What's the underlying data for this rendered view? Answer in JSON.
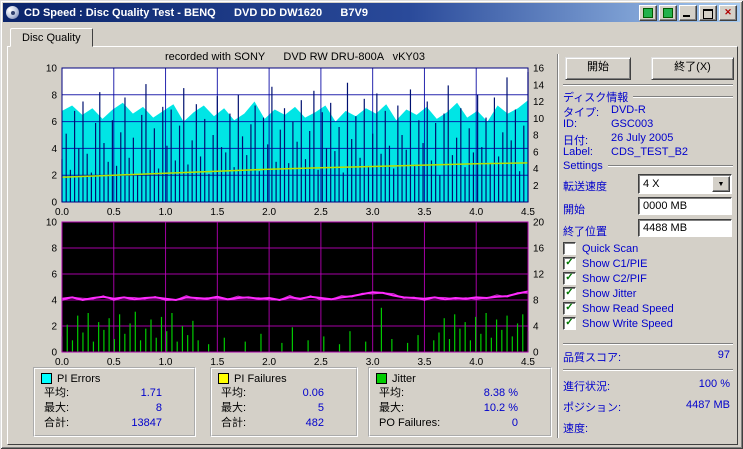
{
  "colors": {
    "panel_text_blue": "#0000cc",
    "check_green": "#007800",
    "titlebar_gradient": [
      "#0a246a",
      "#a6caf0"
    ]
  },
  "window": {
    "title": "CD Speed : Disc Quality Test - BENQ      DVD DD DW1620      B7V9",
    "controls": {
      "close_glyph": "✕"
    }
  },
  "tab": {
    "label": "Disc Quality"
  },
  "chart_header": "recorded with SONY      DVD RW DRU-800A   vKY03",
  "chart_data": [
    {
      "type": "bar",
      "name": "pi-errors-chart",
      "title": "PI Errors (C1/PIE) with write speed",
      "x_range": [
        0,
        4.5
      ],
      "xticks": [
        "0.0",
        "0.5",
        "1.0",
        "1.5",
        "2.0",
        "2.5",
        "3.0",
        "3.5",
        "4.0",
        "4.5"
      ],
      "ylim_left": [
        0,
        10
      ],
      "yticks_left": [
        10,
        8,
        6,
        4,
        2,
        0
      ],
      "ylim_right": [
        0,
        16
      ],
      "yticks_right": [
        16,
        14,
        12,
        10,
        8,
        6,
        4,
        2
      ],
      "grid": true,
      "bg": "#ffffff",
      "grid_color": "#0000a0",
      "border_color": "#000080",
      "stats": {
        "average": 1.71,
        "maximum": 8,
        "total": 13847
      },
      "area": {
        "name": "pie-error-mass",
        "color": "#00e5e5",
        "top_values": [
          6.8,
          7.2,
          6.5,
          7.0,
          6.2,
          6.9,
          7.4,
          6.6,
          7.1,
          6.3,
          6.8,
          7.3,
          6.0,
          6.7,
          7.2,
          6.4,
          7.0,
          6.1,
          6.6,
          7.5,
          6.2,
          6.9,
          6.5,
          7.1,
          6.3,
          6.7,
          7.2,
          6.0,
          6.8,
          6.4,
          7.0,
          6.6,
          7.3,
          6.1,
          6.9,
          6.5,
          7.1,
          6.2,
          6.7,
          7.4,
          6.3,
          6.8,
          6.0,
          7.2,
          6.6,
          7.0,
          7.6
        ]
      },
      "spikes": {
        "name": "pie-error-spikes",
        "color": "#001070",
        "values": [
          3.2,
          5.1,
          2.4,
          6.8,
          4.0,
          7.5,
          3.6,
          2.2,
          5.9,
          8.2,
          4.4,
          3.0,
          6.1,
          2.7,
          5.2,
          7.8,
          3.3,
          4.8,
          2.0,
          6.5,
          8.8,
          3.9,
          5.5,
          2.5,
          7.1,
          4.2,
          6.9,
          3.1,
          5.7,
          8.5,
          2.8,
          4.6,
          7.3,
          3.4,
          6.2,
          2.1,
          5.0,
          7.9,
          4.1,
          3.7,
          6.6,
          2.6,
          8.0,
          4.9,
          3.5,
          5.8,
          7.2,
          2.3,
          6.3,
          4.3,
          8.6,
          3.0,
          5.4,
          7.0,
          2.9,
          6.0,
          4.5,
          7.6,
          3.2,
          5.3,
          8.3,
          2.4,
          6.7,
          4.0,
          7.4,
          3.8,
          5.6,
          2.2,
          8.9,
          4.7,
          6.4,
          3.3,
          7.7,
          2.7,
          5.1,
          8.1,
          3.6,
          6.8,
          4.2,
          2.5,
          7.2,
          5.0,
          3.9,
          8.4,
          2.8,
          6.1,
          4.4,
          7.5,
          3.1,
          5.9,
          2.0,
          6.6,
          8.7,
          3.5,
          4.8,
          7.0,
          2.6,
          5.5,
          3.7,
          8.0,
          4.1,
          6.3,
          2.9,
          7.8,
          3.4,
          5.2,
          9.3,
          4.6,
          6.9,
          2.3,
          5.7,
          9.7
        ]
      },
      "line": {
        "name": "write-speed-line",
        "color": "#b8e000",
        "width": 1.5,
        "fuzz": false,
        "points_y": [
          1.85,
          2.0,
          2.15,
          2.3,
          2.45,
          2.55,
          2.65,
          2.75,
          2.85,
          2.92
        ]
      }
    },
    {
      "type": "bar",
      "name": "pif-jitter-chart",
      "title": "PI Failures (C2/PIF) with Jitter",
      "x_range": [
        0,
        4.5
      ],
      "xticks": [
        "0.0",
        "0.5",
        "1.0",
        "1.5",
        "2.0",
        "2.5",
        "3.0",
        "3.5",
        "4.0",
        "4.5"
      ],
      "ylim_left": [
        0,
        10
      ],
      "yticks_left": [
        10,
        8,
        6,
        4,
        2,
        0
      ],
      "ylim_right": [
        0,
        20
      ],
      "yticks_right": [
        20,
        16,
        12,
        8,
        4,
        0
      ],
      "grid": true,
      "bg": "#000000",
      "grid_color": "#c000c0",
      "border_color": "#aa00aa",
      "stats": {
        "pif_average": 0.06,
        "pif_maximum": 5,
        "pif_total": 482,
        "jitter_average_pct": 8.38,
        "jitter_maximum_pct": 10.2,
        "po_failures": 0
      },
      "spikes": {
        "name": "pif-spikes",
        "color": "#00cc00",
        "values": [
          1.2,
          2.1,
          0.9,
          2.8,
          1.5,
          3.0,
          0.8,
          2.3,
          1.7,
          2.6,
          1.0,
          2.9,
          1.4,
          2.2,
          3.1,
          0.9,
          1.8,
          2.5,
          1.1,
          2.7,
          1.6,
          3.0,
          0.8,
          2.0,
          1.3,
          2.4,
          0.9,
          0,
          0.6,
          0,
          0,
          1.1,
          0,
          0,
          0,
          0.8,
          0,
          0,
          1.4,
          0,
          0,
          0,
          0.7,
          0,
          1.9,
          0,
          0,
          0.9,
          0,
          0,
          1.2,
          0,
          0,
          0.6,
          0,
          1.6,
          0,
          0,
          0.8,
          0,
          0,
          3.4,
          0,
          1.0,
          0,
          0,
          0.7,
          0,
          1.3,
          0,
          0,
          0.9,
          1.5,
          2.6,
          1.0,
          2.9,
          1.8,
          2.3,
          0.9,
          2.7,
          1.4,
          3.0,
          1.1,
          2.5,
          1.7,
          2.8,
          1.2,
          2.2,
          2.9,
          1.6
        ]
      },
      "line": {
        "name": "jitter-line",
        "color": "#ff2bff",
        "width": 2,
        "fuzz": true,
        "points_y": [
          4.1,
          4.2,
          4.0,
          4.15,
          4.25,
          4.1,
          4.2,
          4.05,
          4.15,
          4.2,
          4.1,
          4.0,
          4.2,
          4.15,
          4.1,
          4.25,
          4.05,
          4.15,
          4.2,
          4.1,
          4.15,
          4.0,
          4.2,
          4.1,
          4.25,
          4.15,
          4.05,
          4.2,
          4.3,
          4.45,
          4.6,
          4.55,
          4.35,
          4.2,
          4.15,
          4.1,
          4.2,
          4.05,
          4.15,
          4.1,
          4.2,
          4.15,
          4.25,
          4.3,
          4.5,
          4.65
        ]
      }
    }
  ],
  "legend_boxes": [
    {
      "title": "PI Errors",
      "color": "#00ffff",
      "rows": [
        {
          "label": "平均:",
          "value": "1.71"
        },
        {
          "label": "最大:",
          "value": "8"
        },
        {
          "label": "合計:",
          "value": "13847"
        }
      ]
    },
    {
      "title": "PI Failures",
      "color": "#ffff00",
      "rows": [
        {
          "label": "平均:",
          "value": "0.06"
        },
        {
          "label": "最大:",
          "value": "5"
        },
        {
          "label": "合計:",
          "value": "482"
        }
      ]
    },
    {
      "title": "Jitter",
      "color": "#00cc00",
      "rows": [
        {
          "label": "平均:",
          "value": "8.38 %"
        },
        {
          "label": "最大:",
          "value": "10.2 %"
        },
        {
          "label": "PO Failures:",
          "value": "0"
        }
      ]
    }
  ],
  "panel": {
    "buttons": {
      "start": "開始",
      "exit": "終了(X)"
    },
    "disc_info": {
      "header": "ディスク情報",
      "rows": [
        {
          "label": "タイプ:",
          "value": "DVD-R"
        },
        {
          "label": "ID:",
          "value": "GSC003"
        },
        {
          "label": "日付:",
          "value": "26 July 2005"
        },
        {
          "label": "Label:",
          "value": "CDS_TEST_B2"
        }
      ]
    },
    "settings": {
      "header": "Settings",
      "speed_label": "転送速度",
      "speed_value": "4 X",
      "start_label": "開始",
      "start_value": "0000 MB",
      "end_label": "終了位置",
      "end_value": "4488 MB",
      "checkboxes": [
        {
          "label": "Quick Scan",
          "checked": false
        },
        {
          "label": "Show C1/PIE",
          "checked": true
        },
        {
          "label": "Show C2/PIF",
          "checked": true
        },
        {
          "label": "Show Jitter",
          "checked": true
        },
        {
          "label": "Show Read Speed",
          "checked": true
        },
        {
          "label": "Show Write Speed",
          "checked": true
        }
      ]
    },
    "quality": {
      "label": "品質スコア:",
      "value": "97"
    },
    "progress": [
      {
        "label": "進行状況:",
        "value": "100 %"
      },
      {
        "label": "ポジション:",
        "value": "4487 MB"
      },
      {
        "label": "速度:",
        "value": ""
      }
    ]
  }
}
